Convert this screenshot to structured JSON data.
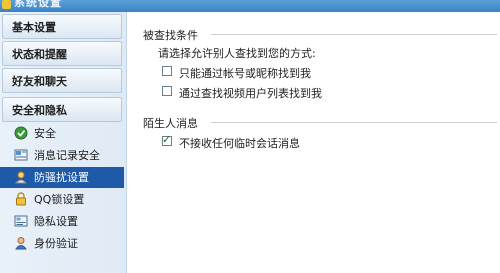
{
  "window": {
    "title": "系统设置"
  },
  "sidebar": {
    "categories": [
      {
        "label": "基本设置"
      },
      {
        "label": "状态和提醒"
      },
      {
        "label": "好友和聊天"
      },
      {
        "label": "安全和隐私"
      }
    ],
    "security_items": [
      {
        "label": "安全",
        "icon": "shield-icon"
      },
      {
        "label": "消息记录安全",
        "icon": "message-record-icon"
      },
      {
        "label": "防骚扰设置",
        "icon": "anti-harassment-icon",
        "selected": true
      },
      {
        "label": "QQ锁设置",
        "icon": "lock-icon"
      },
      {
        "label": "隐私设置",
        "icon": "privacy-icon"
      },
      {
        "label": "身份验证",
        "icon": "user-verify-icon"
      }
    ]
  },
  "main": {
    "find_section": {
      "title": "被查找条件",
      "description": "请选择允许别人查找到您的方式:",
      "options": [
        {
          "label": "只能通过帐号或昵称找到我",
          "checked": false
        },
        {
          "label": "通过查找视频用户列表找到我",
          "checked": false
        }
      ]
    },
    "stranger_section": {
      "title": "陌生人消息",
      "options": [
        {
          "label": "不接收任何临时会话消息",
          "checked": true
        }
      ]
    }
  }
}
